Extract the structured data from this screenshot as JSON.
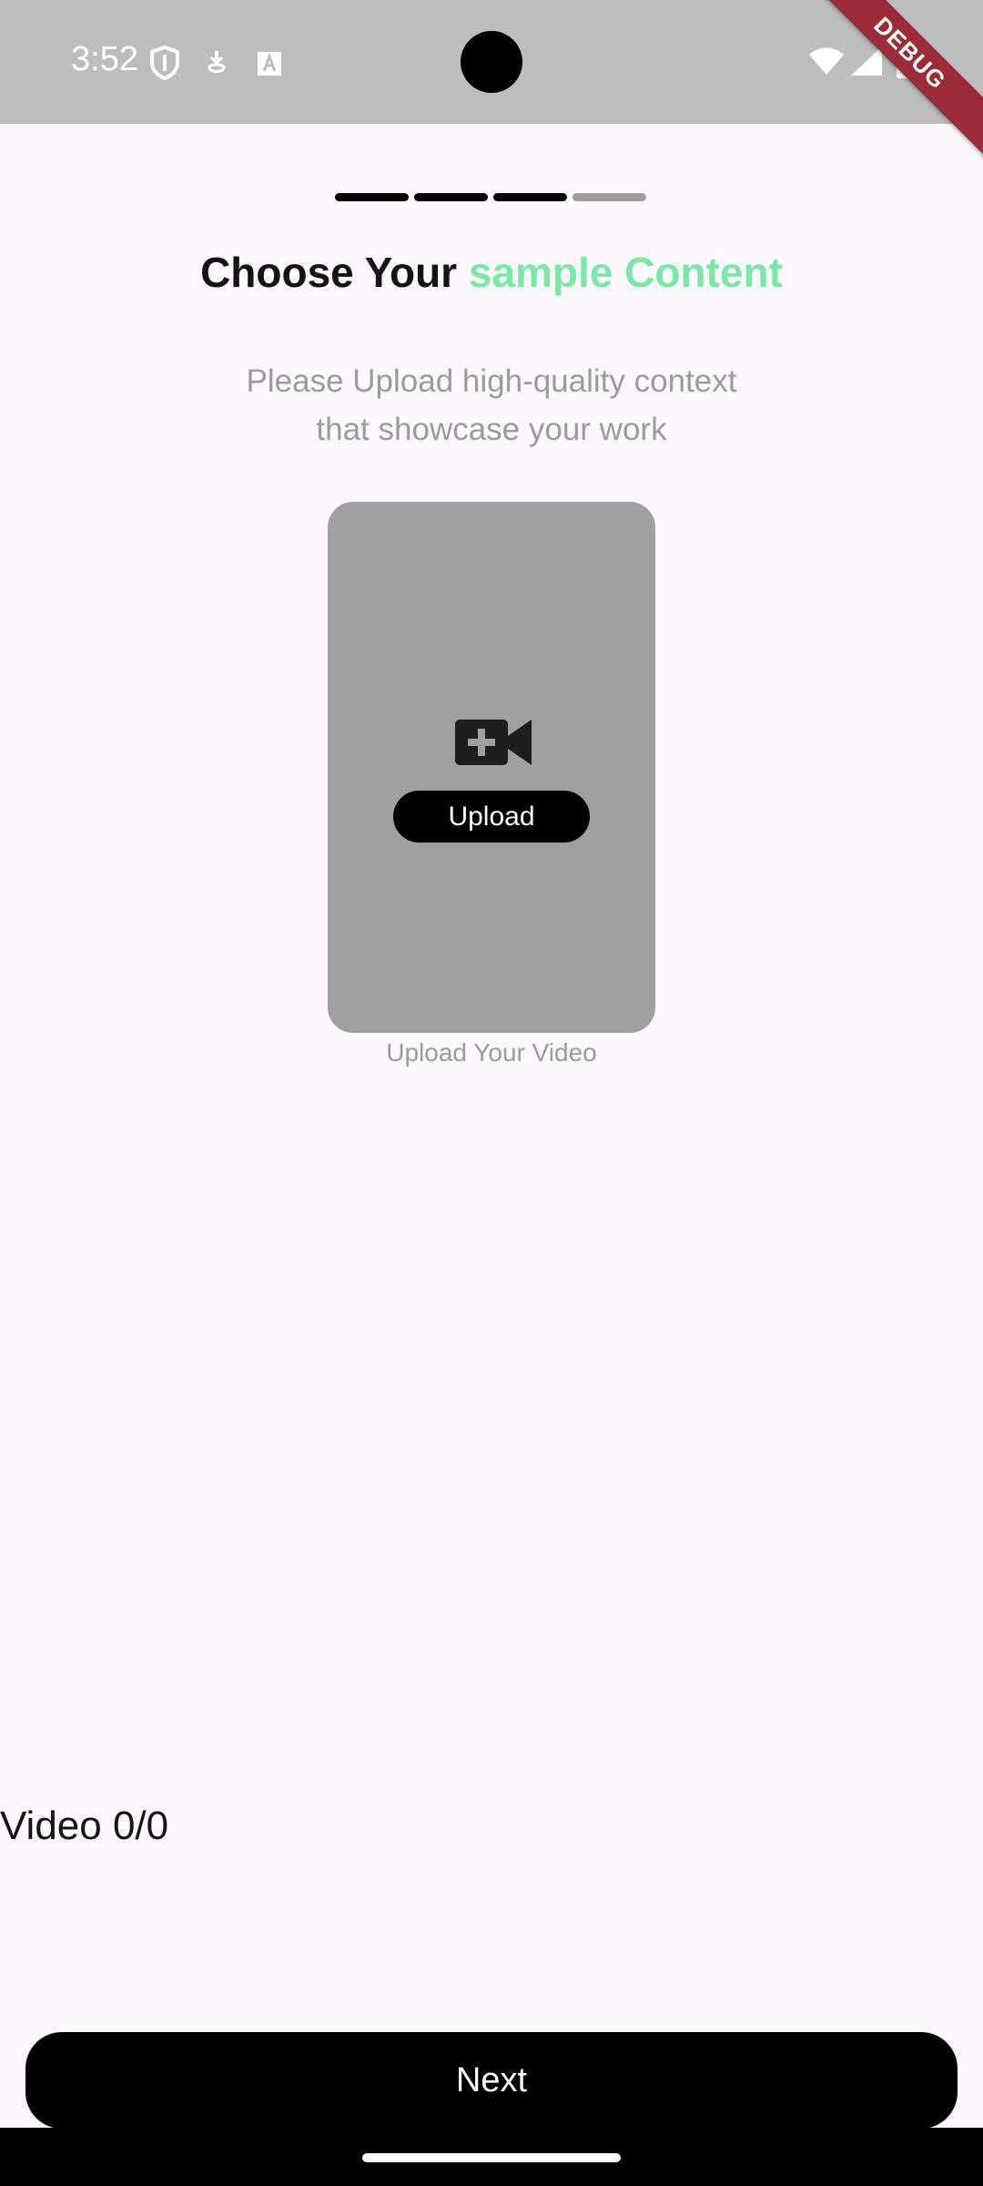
{
  "status_bar": {
    "time": "3:52",
    "left_icons": [
      "shield-icon",
      "download-icon",
      "text-a-icon"
    ],
    "right_icons": [
      "wifi-icon",
      "signal-icon",
      "battery-icon"
    ]
  },
  "debug_banner": "DEBUG",
  "progress": {
    "total_steps": 4,
    "completed_steps": 3
  },
  "header": {
    "title_prefix": "Choose Your ",
    "title_accent": "sample Content",
    "subtitle_line1": "Please Upload high-quality context",
    "subtitle_line2": "that showcase your work"
  },
  "upload": {
    "icon": "video-plus-icon",
    "button_label": "Upload",
    "caption": "Upload Your Video"
  },
  "video_count": "Video 0/0",
  "footer": {
    "next_label": "Next"
  },
  "colors": {
    "accent": "#7be9a6",
    "card": "#a09fa1",
    "status_bar": "#bebcbf",
    "debug_banner": "#9b2b36"
  }
}
